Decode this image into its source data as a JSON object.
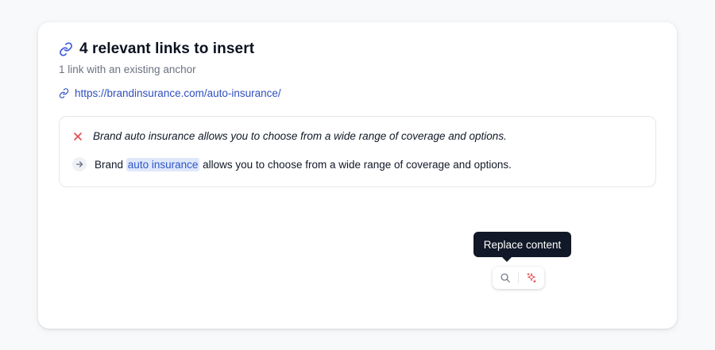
{
  "header": {
    "title": "4 relevant links to insert",
    "link_icon": "link-icon",
    "subtitle": "1 link with an existing anchor"
  },
  "link": {
    "icon": "link-icon",
    "url": "https://brandinsurance.com/auto-insurance/"
  },
  "suggestion": {
    "original_icon": "close-icon",
    "original_text": "Brand auto insurance allows you to choose from a wide range of coverage and options.",
    "new_icon": "arrow-right-icon",
    "new_text_before": "Brand",
    "new_anchor": "auto insurance",
    "new_text_after": "allows you to choose from a wide range of coverage and options."
  },
  "tooltip": {
    "label": "Replace content"
  },
  "actions": {
    "search_icon": "search-icon",
    "replace_icon": "sparkle-icon"
  },
  "colors": {
    "accent": "#2f4fbf",
    "anchor_highlight": "#dfe8fb",
    "remove_red": "#e5484d",
    "tooltip_bg": "#111827"
  }
}
